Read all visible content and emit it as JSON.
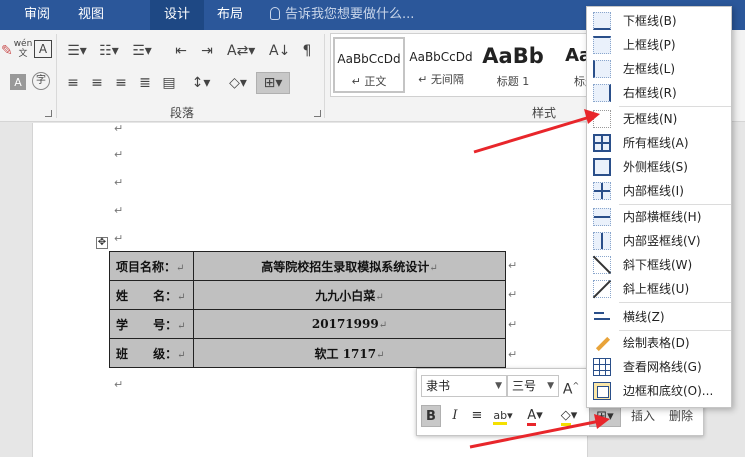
{
  "tabs": [
    {
      "label": "审阅"
    },
    {
      "label": "视图"
    },
    {
      "label": "设计"
    },
    {
      "label": "布局"
    }
  ],
  "tell_me": {
    "text": "告诉我您想要做什么..."
  },
  "ribbon": {
    "paragraph_group_label": "段落",
    "styles_group_label": "样式",
    "styles": [
      {
        "sample": "AaBbCcDd",
        "name": "↵ 正文"
      },
      {
        "sample": "AaBbCcDd",
        "name": "↵ 无间隔"
      },
      {
        "sample": "AaBb",
        "name": "标题 1"
      },
      {
        "sample": "AaB",
        "name": "标题"
      }
    ],
    "font_buttons": {
      "wen": "wén",
      "wen_sub": "文",
      "a_box": "A",
      "a_shade": "A",
      "zi": "字"
    }
  },
  "document": {
    "para_mark": "↵",
    "table": {
      "rows": [
        {
          "label": "项目名称：",
          "value": "高等院校招生录取模拟系统设计"
        },
        {
          "label": "姓      名：",
          "value": "九九小白菜"
        },
        {
          "label": "学      号：",
          "value": "20171999"
        },
        {
          "label": "班      级：",
          "value": "软工 1717"
        }
      ]
    }
  },
  "mini_toolbar": {
    "font": "隶书",
    "size": "三号",
    "grow": "A",
    "bold": "B",
    "italic": "I",
    "insert": "插入",
    "delete": "删除"
  },
  "border_menu": {
    "items": [
      {
        "label": "下框线(B)",
        "icon": "border-bottom-icon",
        "style": "solid-b"
      },
      {
        "label": "上框线(P)",
        "icon": "border-top-icon",
        "style": "solid-t"
      },
      {
        "label": "左框线(L)",
        "icon": "border-left-icon",
        "style": "solid-l"
      },
      {
        "label": "右框线(R)",
        "icon": "border-right-icon",
        "style": "solid-r"
      },
      {
        "label": "无框线(N)",
        "icon": "border-none-icon",
        "style": "none"
      },
      {
        "label": "所有框线(A)",
        "icon": "border-all-icon",
        "style": "all"
      },
      {
        "label": "外侧框线(S)",
        "icon": "border-outside-icon",
        "style": "outside"
      },
      {
        "label": "内部框线(I)",
        "icon": "border-inside-icon",
        "style": "inside"
      },
      {
        "label": "内部横框线(H)",
        "icon": "border-inside-horizontal-icon",
        "style": "insideh"
      },
      {
        "label": "内部竖框线(V)",
        "icon": "border-inside-vertical-icon",
        "style": "insidev"
      },
      {
        "label": "斜下框线(W)",
        "icon": "border-diagonal-down-icon",
        "style": "diag-d"
      },
      {
        "label": "斜上框线(U)",
        "icon": "border-diagonal-up-icon",
        "style": "diag-u"
      },
      {
        "label": "横线(Z)",
        "icon": "horizontal-line-icon",
        "style": "hline"
      },
      {
        "label": "绘制表格(D)",
        "icon": "draw-table-icon",
        "style": "pencil"
      },
      {
        "label": "查看网格线(G)",
        "icon": "view-gridlines-icon",
        "style": "grid"
      },
      {
        "label": "边框和底纹(O)...",
        "icon": "borders-shading-icon",
        "style": "shade"
      }
    ]
  },
  "colors": {
    "ribbon_blue": "#2b579a",
    "arrow_red": "#e8262b",
    "table_fill": "#c0c0c0"
  }
}
